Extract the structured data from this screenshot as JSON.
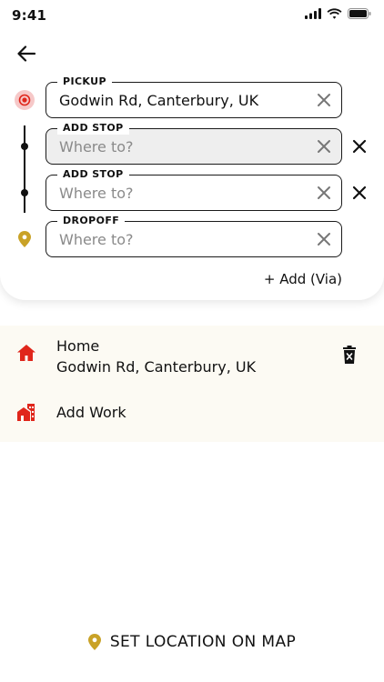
{
  "status_bar": {
    "time": "9:41"
  },
  "route": {
    "pickup": {
      "label": "PICKUP",
      "value": "Godwin Rd, Canterbury, UK",
      "placeholder": ""
    },
    "stops": [
      {
        "label": "ADD STOP",
        "value": "",
        "placeholder": "Where to?"
      },
      {
        "label": "ADD STOP",
        "value": "",
        "placeholder": "Where to?"
      }
    ],
    "dropoff": {
      "label": "DROPOFF",
      "value": "",
      "placeholder": "Where to?"
    },
    "add_via_label": "+ Add (Via)"
  },
  "saved_places": [
    {
      "title": "Home",
      "address": "Godwin Rd, Canterbury, UK",
      "icon": "home-icon"
    },
    {
      "title": "Add Work",
      "icon": "work-icon"
    }
  ],
  "set_location_label": "SET LOCATION ON MAP",
  "colors": {
    "accent_red": "#e0261b",
    "pin_gold": "#c9a227",
    "places_bg": "#fcfaf3"
  }
}
